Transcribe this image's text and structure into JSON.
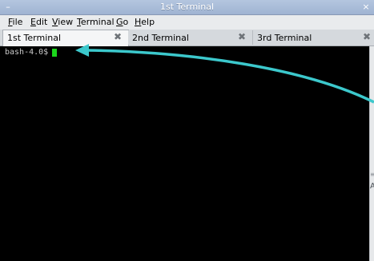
{
  "window": {
    "title": "1st Terminal"
  },
  "menu": [
    {
      "underline": "F",
      "rest": "ile"
    },
    {
      "underline": "E",
      "rest": "dit"
    },
    {
      "underline": "V",
      "rest": "iew"
    },
    {
      "underline": "T",
      "rest": "erminal"
    },
    {
      "underline": "G",
      "rest": "o"
    },
    {
      "underline": "H",
      "rest": "elp"
    }
  ],
  "tabs": [
    {
      "label": "1st Terminal",
      "active": true
    },
    {
      "label": "2nd Terminal",
      "active": false
    },
    {
      "label": "3rd Terminal",
      "active": false
    }
  ],
  "terminal": {
    "prompt": "bash-4.0$"
  },
  "colors": {
    "cursor": "#1bd61b",
    "arrow": "#3cc8cc"
  },
  "scrollbar": {
    "glyph": "≡",
    "letter": "A"
  }
}
